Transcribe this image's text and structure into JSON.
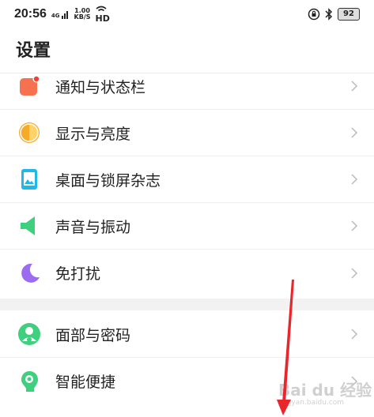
{
  "status_bar": {
    "time": "20:56",
    "network": "4G",
    "speed_value": "1.00",
    "speed_unit": "KB/S",
    "hd": "HD",
    "battery": "92"
  },
  "header": {
    "title": "设置"
  },
  "settings": {
    "group1": [
      {
        "label": "通知与状态栏",
        "icon": "notification-icon",
        "color": "#f5714f"
      },
      {
        "label": "显示与亮度",
        "icon": "display-brightness-icon",
        "color": "#f7a928"
      },
      {
        "label": "桌面与锁屏杂志",
        "icon": "wallpaper-icon",
        "color": "#1fb8e8"
      },
      {
        "label": "声音与振动",
        "icon": "sound-icon",
        "color": "#3ecf7f"
      },
      {
        "label": "免打扰",
        "icon": "moon-icon",
        "color": "#9b6cf0"
      }
    ],
    "group2": [
      {
        "label": "面部与密码",
        "icon": "face-password-icon",
        "color": "#3ecf7f"
      },
      {
        "label": "智能便捷",
        "icon": "smart-assist-icon",
        "color": "#3ecf7f"
      }
    ]
  },
  "watermark": {
    "text": "Bai du 经验",
    "sub": "jingyan.baidu.com"
  },
  "colors": {
    "annotation_arrow": "#e8262b",
    "divider": "#eeeeee",
    "band": "#f2f2f2"
  }
}
